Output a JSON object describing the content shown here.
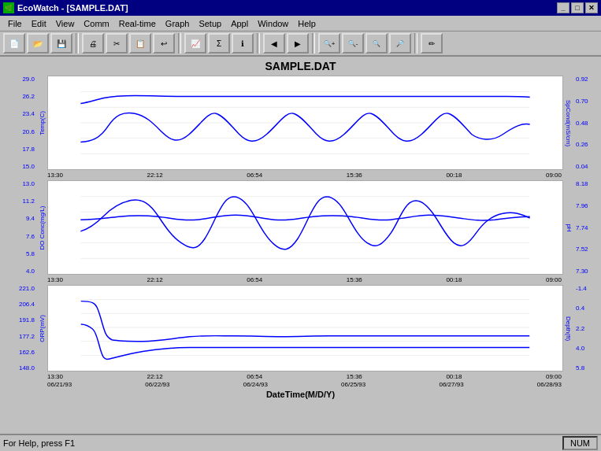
{
  "titleBar": {
    "title": "EcoWatch - [SAMPLE.DAT]",
    "icon": "🌿"
  },
  "menuBar": {
    "items": [
      "File",
      "Edit",
      "View",
      "Comm",
      "Real-time",
      "Graph",
      "Setup",
      "Appl",
      "Window",
      "Help"
    ]
  },
  "toolbar": {
    "buttons": [
      "📄",
      "💾",
      "🖨",
      "✂",
      "📋",
      "↩",
      "🔍",
      "📊",
      "Σ",
      "ℹ",
      "◀",
      "▶",
      "🔍",
      "🔍",
      "🔍",
      "🔍",
      "✏"
    ]
  },
  "chartTitle": "SAMPLE.DAT",
  "charts": [
    {
      "id": "chart1",
      "yLabelLeft": "Temp(C)",
      "yLabelRight": "SpCond(mS/cm)",
      "yTicksLeft": [
        "29.0",
        "26.2",
        "23.4",
        "20.6",
        "17.8",
        "15.0"
      ],
      "yTicksRight": [
        "0.92",
        "0.70",
        "0.48",
        "0.26",
        "0.04"
      ]
    },
    {
      "id": "chart2",
      "yLabelLeft": "DO Conc(mg/L)",
      "yLabelRight": "pH",
      "yTicksLeft": [
        "13.0",
        "11.2",
        "9.4",
        "7.6",
        "5.8",
        "4.0"
      ],
      "yTicksRight": [
        "8.18",
        "7.96",
        "7.74",
        "7.52",
        "7.30"
      ]
    },
    {
      "id": "chart3",
      "yLabelLeft": "ORP(mV)",
      "yLabelRight": "Depth(ft)",
      "yTicksLeft": [
        "221.0",
        "206.4",
        "191.8",
        "177.2",
        "162.6",
        "148.0"
      ],
      "yTicksRight": [
        "-1.4",
        "0.4",
        "2.2",
        "4.0",
        "5.8"
      ]
    }
  ],
  "xTicks": [
    "13:30",
    "22:12",
    "06:54",
    "15:36",
    "00:18",
    "09:00"
  ],
  "dateTicks": [
    "06/21/93",
    "06/22/93",
    "06/24/93",
    "06/25/93",
    "06/27/93",
    "06/28/93"
  ],
  "xAxisLabel": "DateTime(M/D/Y)",
  "statusBar": {
    "helpText": "For Help, press F1",
    "indicator": "NUM"
  }
}
